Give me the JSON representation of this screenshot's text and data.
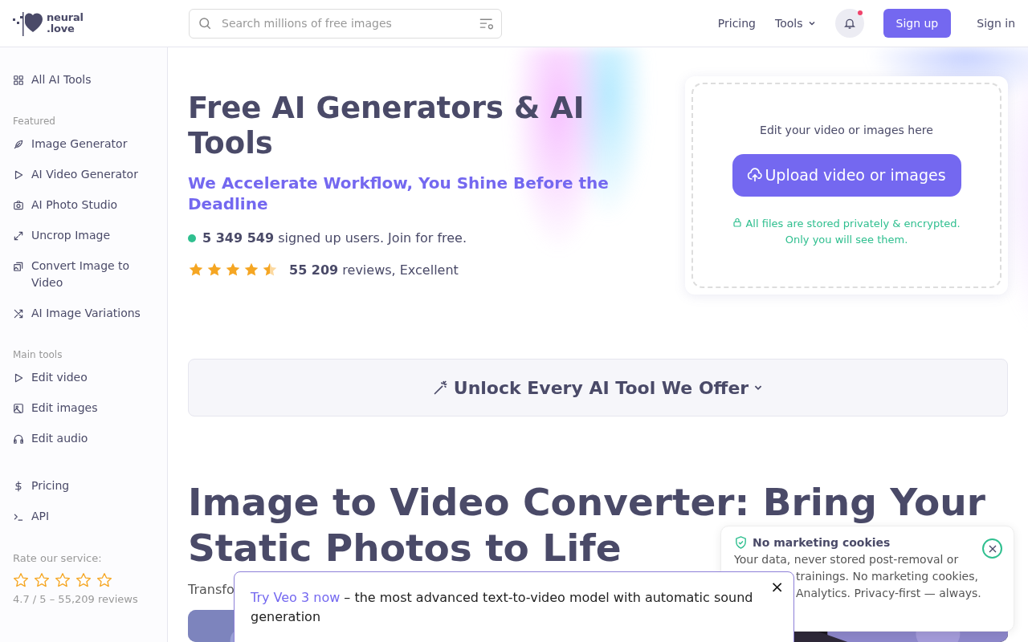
{
  "header": {
    "logo": [
      "neural",
      ".love"
    ],
    "search": {
      "placeholder": "Search millions of free images"
    },
    "nav": [
      "Pricing",
      "Tools"
    ],
    "notification_dot": true,
    "signup": "Sign up",
    "signin": "Sign in"
  },
  "sidebar": {
    "sections": [
      {
        "items": [
          {
            "label": "All AI Tools"
          }
        ]
      },
      {
        "title": "Featured",
        "items": [
          {
            "label": "Image Generator"
          },
          {
            "label": "AI Video Generator"
          },
          {
            "label": "AI Photo Studio"
          },
          {
            "label": "Uncrop Image"
          },
          {
            "label": "Convert Image to Video"
          },
          {
            "label": "AI Image Variations"
          }
        ]
      },
      {
        "title": "Main tools",
        "items": [
          {
            "label": "Edit video"
          },
          {
            "label": "Edit images"
          },
          {
            "label": "Edit audio"
          }
        ]
      },
      {
        "items": [
          {
            "label": "Pricing"
          },
          {
            "label": "API"
          }
        ]
      }
    ],
    "rating": {
      "label": "Rate our service:",
      "stars": 0,
      "summary": "4.7 / 5 – 55,209 reviews"
    }
  },
  "hero": {
    "title": "Free AI Generators & AI Tools",
    "subtitle": "We Accelerate Workflow, You Shine Before the Deadline",
    "users": "**5 349 549** signed up users. Join for free.",
    "stars": 4.5,
    "reviews": "**55 209** reviews, Excellent"
  },
  "upload_card": {
    "prompt": "Edit your video or images here",
    "button": "Upload video or images",
    "note": "All files are stored privately & encrypted. Only you will see them."
  },
  "unlock_button": "Unlock Every AI Tool We Offer",
  "article": {
    "title_lines": [
      "Image to Video Converter: Bring Your",
      "Static Photos to Life"
    ],
    "intro": "Transfo"
  },
  "cookie_popup": {
    "title": "No marketing cookies",
    "lines": [
      "Your data, never stored post-removal or",
      "trainings. No marketing cookies,",
      "Analytics. Privacy-first — always."
    ]
  },
  "promo_popup": {
    "link": "Try Veo 3 now",
    "text": " – the most advanced text-to-video model with automatic sound generation",
    "close": "×"
  }
}
